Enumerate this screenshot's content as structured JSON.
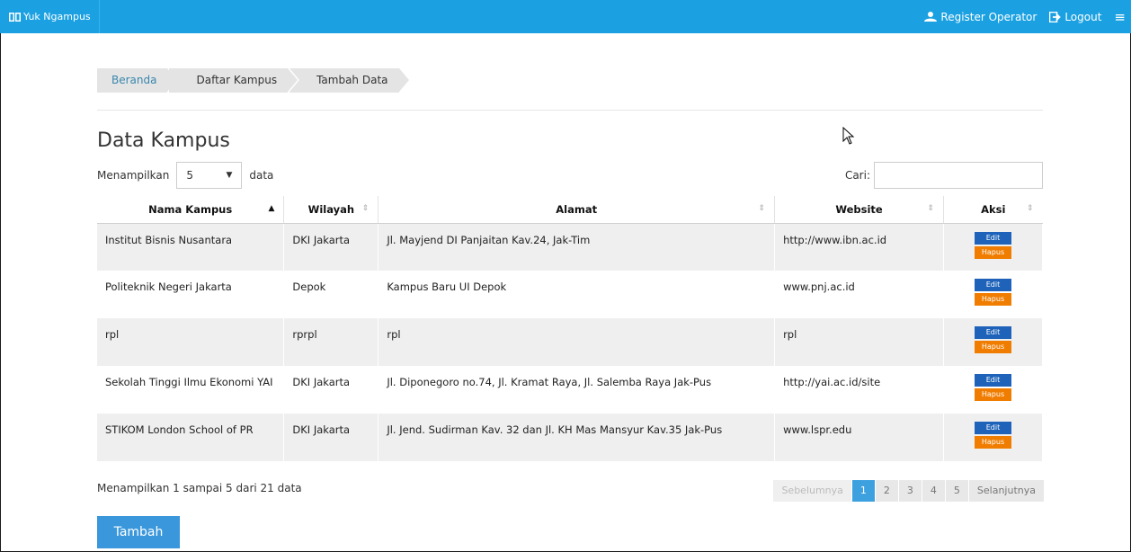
{
  "navbar": {
    "brand": "Yuk Ngampus",
    "register": "Register Operator",
    "logout": "Logout",
    "accent": "#1ba1e2"
  },
  "breadcrumb": [
    "Beranda",
    "Daftar Kampus",
    "Tambah Data"
  ],
  "page": {
    "title": "Data Kampus",
    "length_prefix": "Menampilkan",
    "length_value": "5",
    "length_suffix": "data",
    "search_label": "Cari:",
    "search_value": ""
  },
  "table": {
    "columns": [
      "Nama Kampus",
      "Wilayah",
      "Alamat",
      "Website",
      "Aksi"
    ],
    "rows": [
      [
        "Institut Bisnis Nusantara",
        "DKI Jakarta",
        "Jl. Mayjend DI Panjaitan Kav.24, Jak-Tim",
        "http://www.ibn.ac.id"
      ],
      [
        "Politeknik Negeri Jakarta",
        "Depok",
        "Kampus Baru UI Depok",
        "www.pnj.ac.id"
      ],
      [
        "rpl",
        "rprpl",
        "rpl",
        "rpl"
      ],
      [
        "Sekolah Tinggi Ilmu Ekonomi YAI",
        "DKI Jakarta",
        "Jl. Diponegoro no.74, Jl. Kramat Raya, Jl. Salemba Raya Jak-Pus",
        "http://yai.ac.id/site"
      ],
      [
        "STIKOM London School of PR",
        "DKI Jakarta",
        "Jl. Jend. Sudirman Kav. 32 dan Jl. KH Mas Mansyur Kav.35 Jak-Pus",
        "www.lspr.edu"
      ]
    ],
    "edit_label": "Edit",
    "delete_label": "Hapus"
  },
  "footer": {
    "info": "Menampilkan 1 sampai 5 dari 21 data",
    "prev": "Sebelumnya",
    "pages": [
      "1",
      "2",
      "3",
      "4",
      "5"
    ],
    "next": "Selanjutnya",
    "add_button": "Tambah"
  }
}
